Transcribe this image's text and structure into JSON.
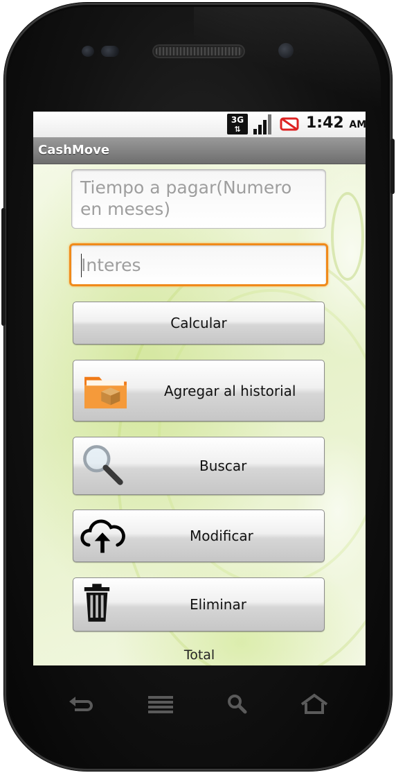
{
  "status_bar": {
    "network": "3G",
    "time": "1:42",
    "ampm": "AM",
    "icons": [
      "3g-data-icon",
      "signal-strength-icon",
      "no-sim-icon"
    ]
  },
  "app": {
    "title": "CashMove"
  },
  "form": {
    "months_placeholder": "Tiempo a pagar(Numero en meses)",
    "interest_placeholder": "Interes"
  },
  "buttons": {
    "calcular": "Calcular",
    "agregar": "Agregar al historial",
    "buscar": "Buscar",
    "modificar": "Modificar",
    "eliminar": "Eliminar"
  },
  "total_label": "Total",
  "soft_keys": [
    "back-icon",
    "menu-icon",
    "search-icon",
    "home-icon"
  ],
  "colors": {
    "focus_orange": "#f08a1a",
    "titlebar_gray": "#7a7a7a",
    "background_green": "#e6f1c8"
  }
}
